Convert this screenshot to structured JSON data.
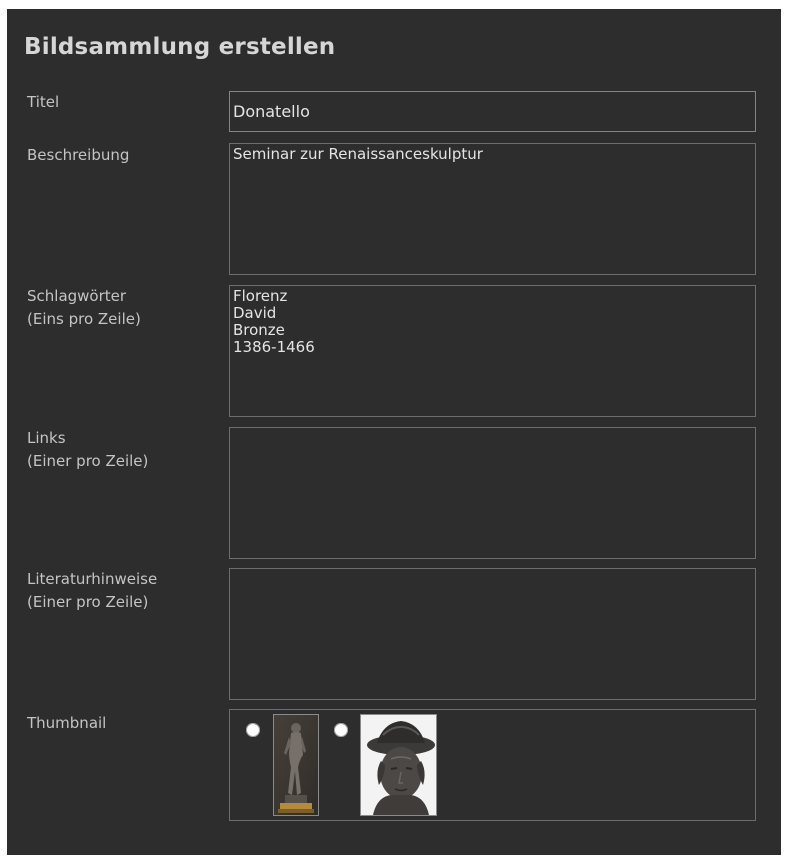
{
  "page": {
    "title": "Bildsammlung erstellen"
  },
  "form": {
    "title": {
      "label": "Titel",
      "value": "Donatello"
    },
    "description": {
      "label": "Beschreibung",
      "value": "Seminar zur Renaissanceskulptur"
    },
    "keywords": {
      "label": "Schlagwörter",
      "hint": "(Eins pro Zeile)",
      "value": "Florenz\nDavid\nBronze\n1386-1466"
    },
    "links": {
      "label": "Links",
      "hint": "(Einer pro Zeile)",
      "value": ""
    },
    "literature": {
      "label": "Literaturhinweise",
      "hint": "(Einer pro Zeile)",
      "value": ""
    },
    "thumbnail": {
      "label": "Thumbnail",
      "options": [
        {
          "image": "donatello-david-full-statue",
          "selected": false
        },
        {
          "image": "donatello-david-head-closeup",
          "selected": false
        }
      ]
    }
  },
  "colors": {
    "background": "#2d2d2d",
    "border": "#6d6d6d",
    "focus_border": "#b9773c",
    "text": "#c4c4c4"
  }
}
